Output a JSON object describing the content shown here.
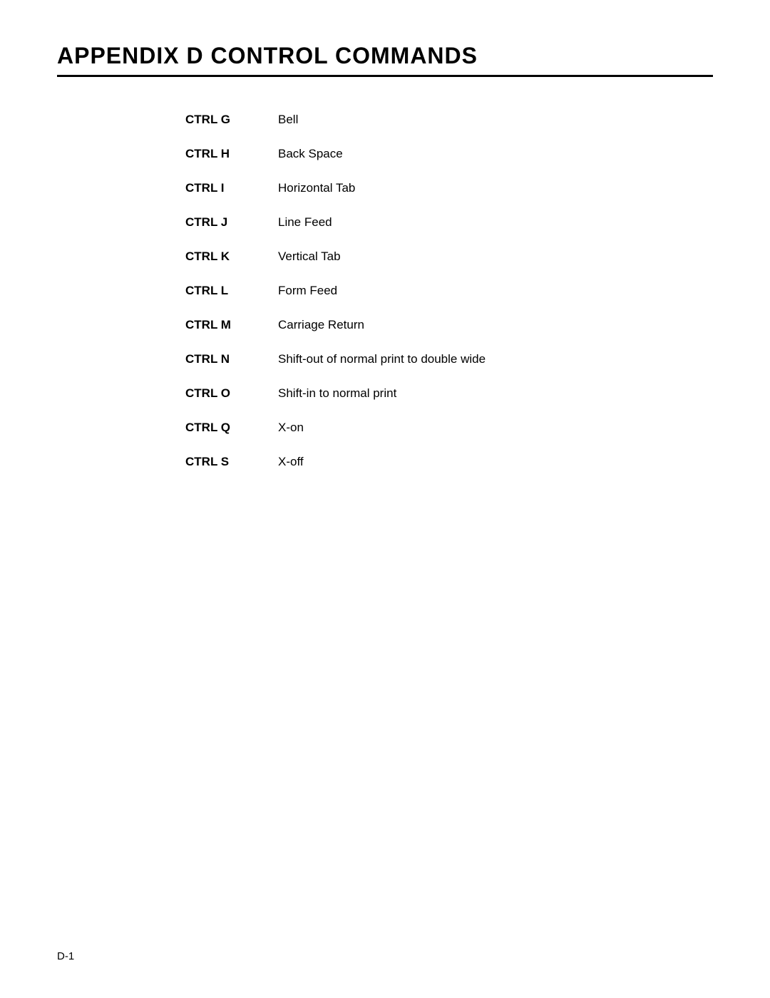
{
  "page": {
    "title": "APPENDIX D CONTROL COMMANDS",
    "footer": "D-1",
    "commands": [
      {
        "key": "CTRL G",
        "description": "Bell"
      },
      {
        "key": "CTRL H",
        "description": "Back Space"
      },
      {
        "key": "CTRL I",
        "description": "Horizontal Tab"
      },
      {
        "key": "CTRL J",
        "description": "Line Feed"
      },
      {
        "key": "CTRL K",
        "description": "Vertical Tab"
      },
      {
        "key": "CTRL L",
        "description": "Form Feed"
      },
      {
        "key": "CTRL M",
        "description": "Carriage Return"
      },
      {
        "key": "CTRL N",
        "description": "Shift-out of normal print to double wide"
      },
      {
        "key": "CTRL O",
        "description": "Shift-in to normal print"
      },
      {
        "key": "CTRL Q",
        "description": "X-on"
      },
      {
        "key": "CTRL S",
        "description": "X-off"
      }
    ]
  }
}
